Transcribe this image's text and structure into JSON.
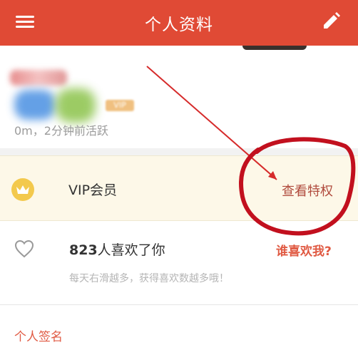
{
  "header": {
    "title": "个人资料",
    "menu_icon": "menu-icon",
    "edit_icon": "pencil-icon"
  },
  "profile": {
    "status": "0m，2分钟前活跃"
  },
  "vip": {
    "label": "VIP会员",
    "link": "查看特权",
    "icon": "crown-icon"
  },
  "likes": {
    "count": "823",
    "suffix": "人喜欢了你",
    "link": "谁喜欢我?",
    "hint": "每天右滑越多，获得喜欢数越多哦！",
    "icon": "heart-icon"
  },
  "signature": {
    "label": "个人签名"
  },
  "colors": {
    "accent": "#e04a35",
    "vip_bg": "#fdf8e8",
    "annotation": "#c2101e"
  }
}
